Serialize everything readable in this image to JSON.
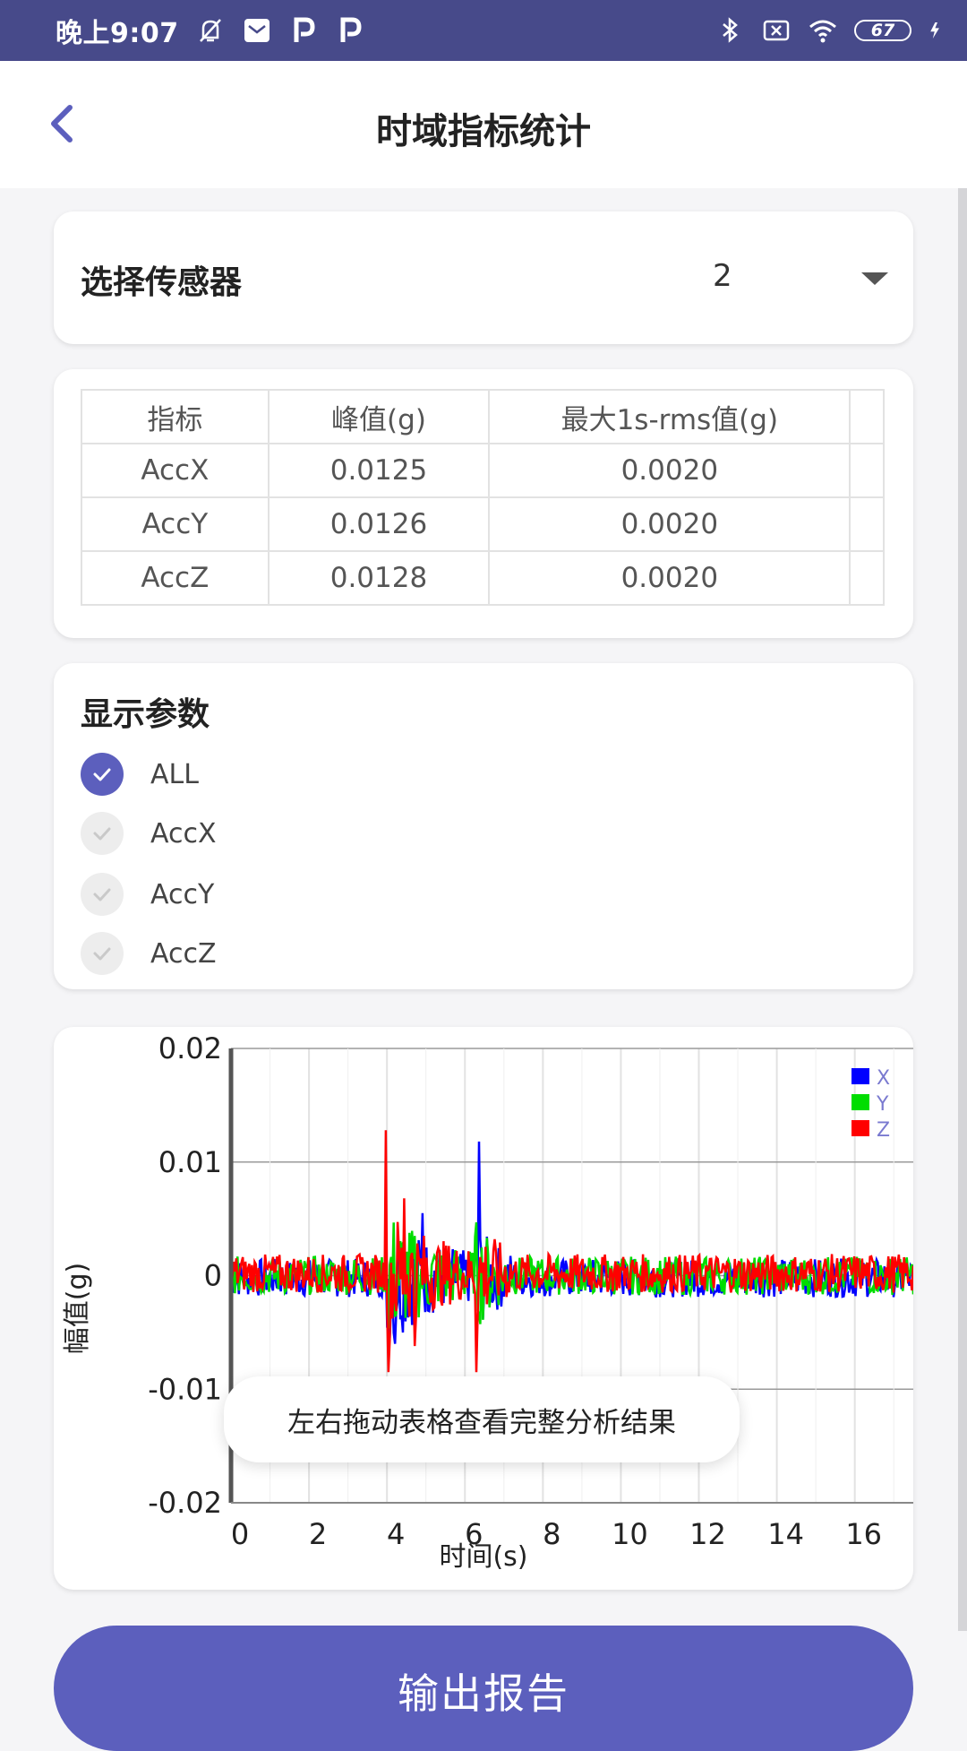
{
  "status_bar": {
    "time": "晚上9:07",
    "battery_level": "67"
  },
  "header": {
    "title": "时域指标统计"
  },
  "sensor": {
    "label": "选择传感器",
    "value": "2"
  },
  "table": {
    "columns": [
      "指标",
      "峰值(g)",
      "最大1s-rms值(g)"
    ],
    "rows": [
      [
        "AccX",
        "0.0125",
        "0.0020"
      ],
      [
        "AccY",
        "0.0126",
        "0.0020"
      ],
      [
        "AccZ",
        "0.0128",
        "0.0020"
      ]
    ]
  },
  "params": {
    "title": "显示参数",
    "options": [
      {
        "label": "ALL",
        "checked": true
      },
      {
        "label": "AccX",
        "checked": false
      },
      {
        "label": "AccY",
        "checked": false
      },
      {
        "label": "AccZ",
        "checked": false
      }
    ]
  },
  "chart_data": {
    "type": "line",
    "xlabel": "时间(s)",
    "ylabel": "幅值(g)",
    "xlim": [
      0,
      17.5
    ],
    "ylim": [
      -0.02,
      0.02
    ],
    "x_ticks": [
      0,
      2,
      4,
      6,
      8,
      10,
      12,
      14,
      16
    ],
    "x_tick_labels": [
      "0",
      "2",
      "4",
      "6",
      "8",
      "10",
      "12",
      "14",
      "16"
    ],
    "y_ticks": [
      0.02,
      0.01,
      0,
      -0.01,
      -0.02
    ],
    "y_tick_labels": [
      "0.02",
      "0.01",
      "0",
      "-0.01",
      "-0.02"
    ],
    "grid": true,
    "legend": "top-right",
    "series": [
      {
        "name": "X",
        "color": "#0000FF",
        "peak": 0.0125
      },
      {
        "name": "Y",
        "color": "#00DD00",
        "peak": 0.0126
      },
      {
        "name": "Z",
        "color": "#FF0000",
        "peak": 0.0128
      }
    ]
  },
  "toast": {
    "message": "左右拖动表格查看完整分析结果"
  },
  "report_button": {
    "label": "输出报告"
  },
  "colors": {
    "accent": "#5C5FBD",
    "status_bar": "#474A8A",
    "background": "#F5F5F7"
  }
}
